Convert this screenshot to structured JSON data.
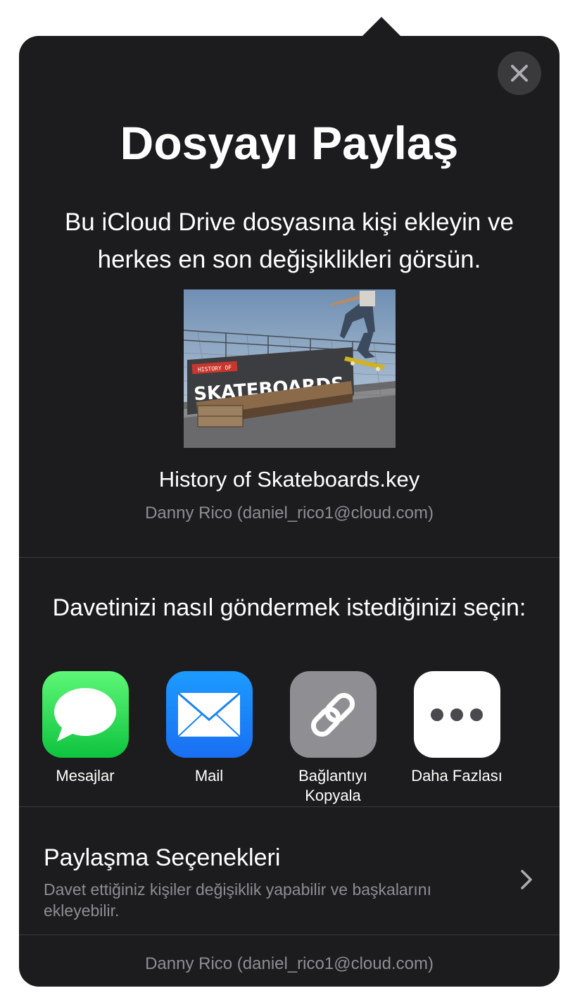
{
  "dialog": {
    "title": "Dosyayı Paylaş",
    "subtitle": "Bu iCloud Drive dosyasına kişi ekleyin ve herkes en son değişiklikleri görsün.",
    "close_icon": "close-icon"
  },
  "file": {
    "thumbnail_label_small": "HISTORY OF",
    "thumbnail_label_big": "SKATEBOARDS",
    "name": "History of Skateboards.key",
    "owner": "Danny Rico (daniel_rico1@cloud.com)"
  },
  "invite": {
    "prompt": "Davetinizi nasıl göndermek istediğinizi seçin:",
    "methods": [
      {
        "label": "Mesajlar",
        "icon": "messages-icon",
        "color": "#34c759"
      },
      {
        "label": "Mail",
        "icon": "mail-icon",
        "color": "#1a8cff"
      },
      {
        "label": "Bağlantıyı Kopyala",
        "icon": "link-icon",
        "color": "#8e8e93"
      },
      {
        "label": "Daha Fazlası",
        "icon": "more-icon",
        "color": "#ffffff"
      }
    ]
  },
  "share_options": {
    "title": "Paylaşma Seçenekleri",
    "description": "Davet ettiğiniz kişiler değişiklik yapabilir ve başkalarını ekleyebilir.",
    "chevron_icon": "chevron-right-icon"
  },
  "footer": {
    "owner": "Danny Rico (daniel_rico1@cloud.com)"
  },
  "colors": {
    "sheet_background": "#1c1c1e",
    "secondary_text": "#8e8e93",
    "separator": "#3a3a3c"
  }
}
